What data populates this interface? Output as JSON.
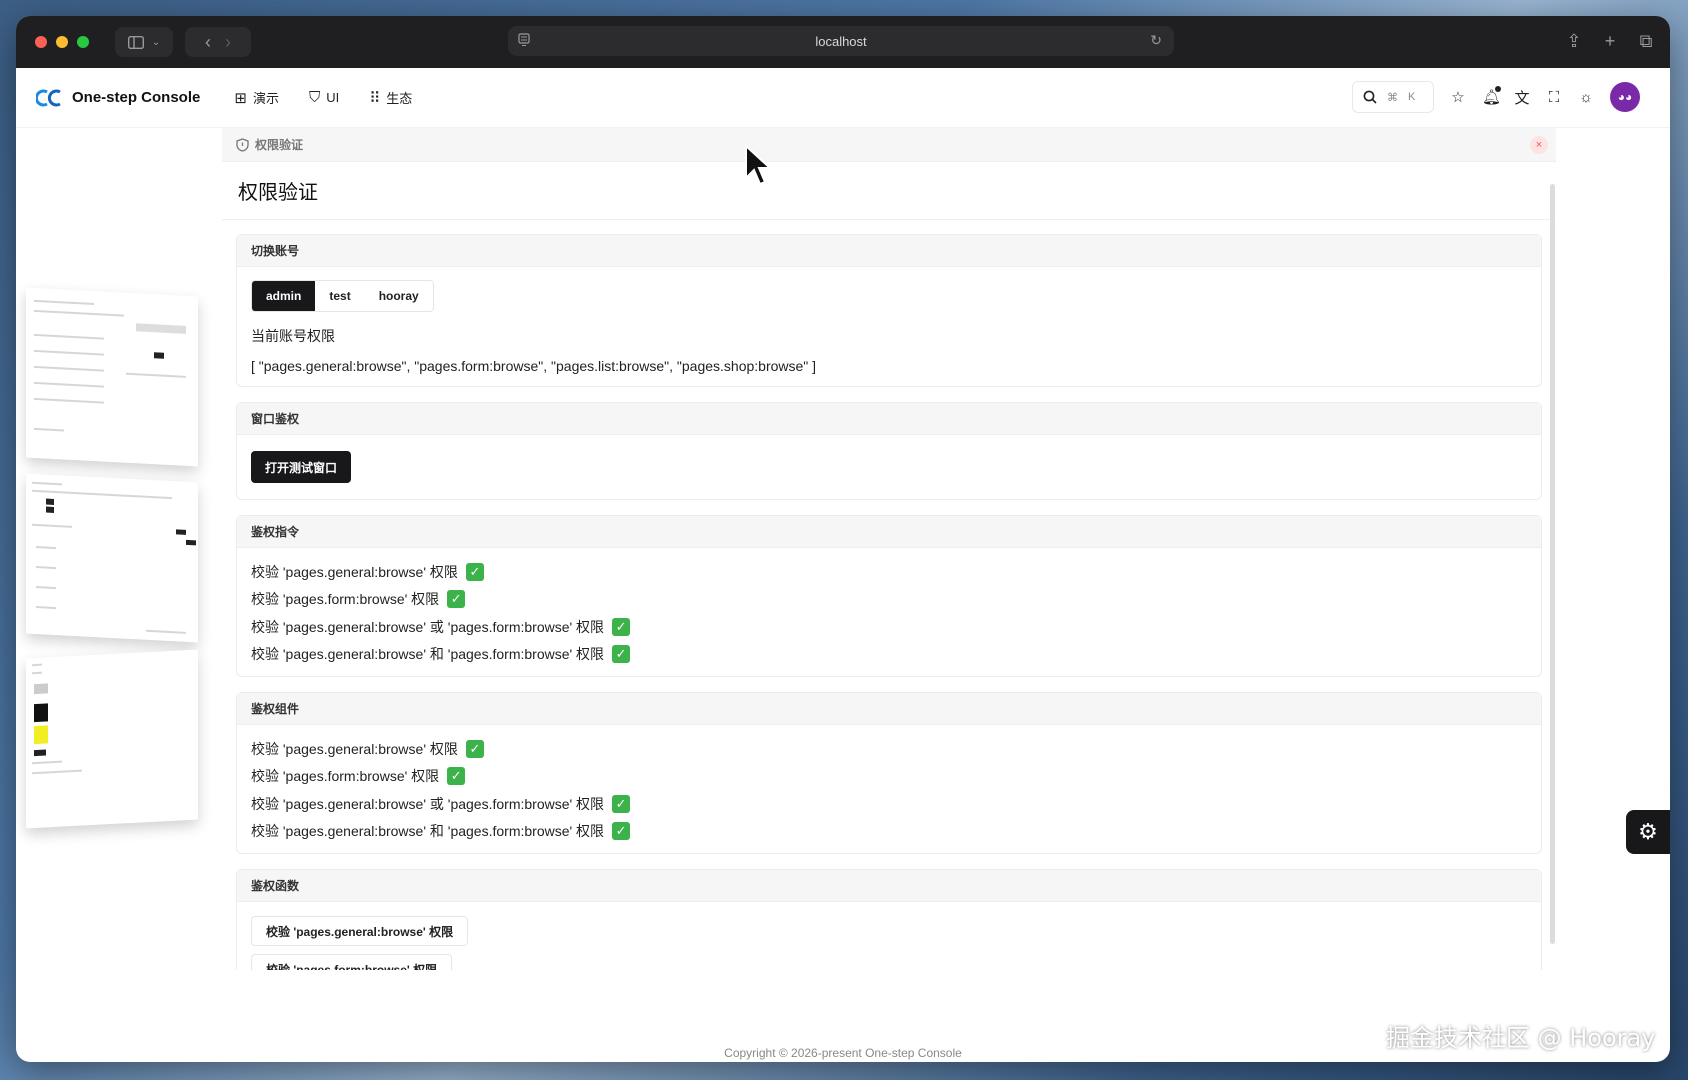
{
  "browser": {
    "url": "localhost"
  },
  "app": {
    "title": "One-step Console",
    "nav": [
      {
        "icon": "grid-icon",
        "label": "演示"
      },
      {
        "icon": "shield-icon",
        "label": "UI"
      },
      {
        "icon": "apps-icon",
        "label": "生态"
      }
    ],
    "search_shortcut": [
      "⌘",
      "K"
    ]
  },
  "tab": {
    "label": "权限验证"
  },
  "page": {
    "title": "权限验证",
    "account": {
      "header": "切换账号",
      "options": [
        "admin",
        "test",
        "hooray"
      ],
      "selected": "admin",
      "perm_label": "当前账号权限",
      "perm_value": "[ \"pages.general:browse\", \"pages.form:browse\", \"pages.list:browse\", \"pages.shop:browse\" ]"
    },
    "window_auth": {
      "header": "窗口鉴权",
      "button": "打开测试窗口"
    },
    "directive": {
      "header": "鉴权指令",
      "items": [
        "校验 'pages.general:browse' 权限",
        "校验 'pages.form:browse' 权限",
        "校验 'pages.general:browse' 或 'pages.form:browse' 权限",
        "校验 'pages.general:browse' 和 'pages.form:browse' 权限"
      ]
    },
    "component": {
      "header": "鉴权组件",
      "items": [
        "校验 'pages.general:browse' 权限",
        "校验 'pages.form:browse' 权限",
        "校验 'pages.general:browse' 或 'pages.form:browse' 权限",
        "校验 'pages.general:browse' 和 'pages.form:browse' 权限"
      ]
    },
    "function": {
      "header": "鉴权函数",
      "buttons": [
        "校验 'pages.general:browse' 权限",
        "校验 'pages.form:browse' 权限"
      ]
    }
  },
  "footer": {
    "text": "Copyright © 2026-present  One-step Console"
  },
  "watermark": "掘金技术社区 @ Hooray",
  "colors": {
    "accent": "#18181b",
    "check": "#3cb34a",
    "logo": "#1e88e5"
  }
}
